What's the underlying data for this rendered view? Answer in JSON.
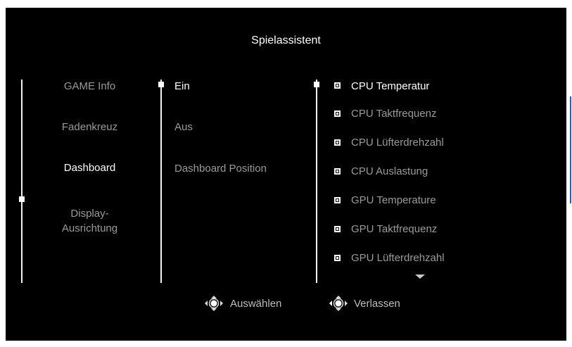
{
  "title": "Spielassistent",
  "col1": {
    "items": [
      "GAME Info",
      "Fadenkreuz",
      "Dashboard",
      "Display-\nAusrichtung"
    ],
    "selected_index": 2
  },
  "col2": {
    "items": [
      "Ein",
      "Aus",
      "Dashboard Position"
    ],
    "selected_index": 0
  },
  "col3": {
    "items": [
      "CPU Temperatur",
      "CPU Taktfrequenz",
      "CPU Lüfterdrehzahl",
      "CPU Auslastung",
      "GPU Temperature",
      "GPU Taktfrequenz",
      "GPU Lüfterdrehzahl"
    ],
    "selected_index": 0
  },
  "footer": {
    "select_label": "Auswählen",
    "exit_label": "Verlassen"
  },
  "colors": {
    "background": "#000000",
    "text_active": "#ffffff",
    "text_inactive": "#9a9a9a",
    "scrollbar": "#1e5fd8"
  }
}
